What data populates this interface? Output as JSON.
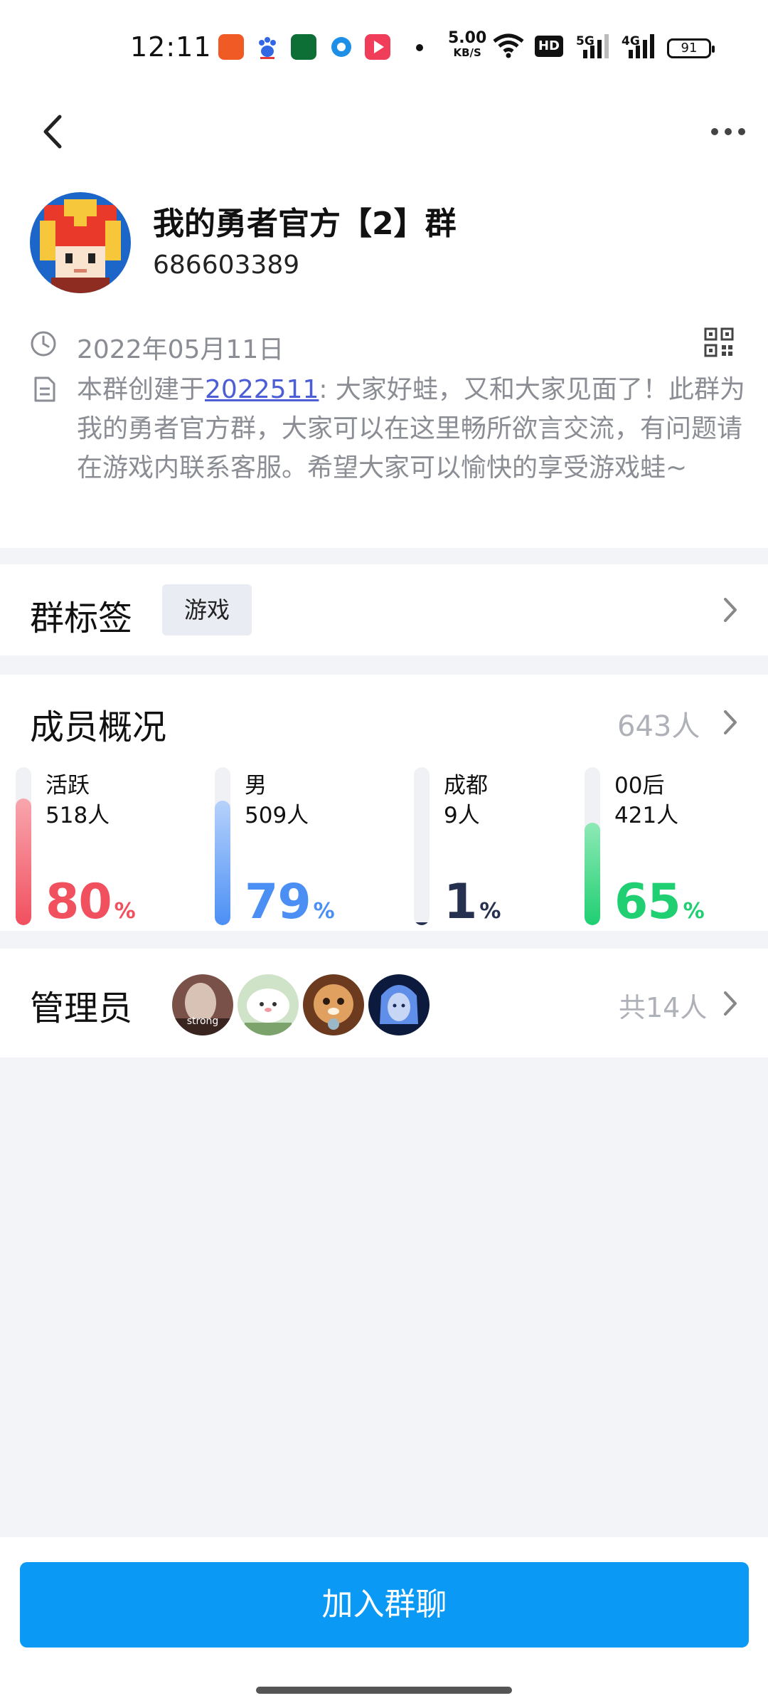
{
  "status_bar": {
    "time": "12:11",
    "net_speed_value": "5.00",
    "net_speed_unit": "KB/S",
    "battery": "91",
    "signal_labels": [
      "HD",
      "5G",
      "4G"
    ]
  },
  "header": {
    "back_icon": "chevron-left-icon",
    "more_icon": "more-dots-icon"
  },
  "group": {
    "name": "我的勇者官方【2】群",
    "id": "686603389",
    "created_date": "2022年05月11日",
    "description_prefix": "本群创建于",
    "description_link": "2022511",
    "description_suffix": ": 大家好蛙，又和大家见面了！此群为我的勇者官方群，大家可以在这里畅所欲言交流，有问题请在游戏内联系客服。希望大家可以愉快的享受游戏蛙~"
  },
  "tags": {
    "title": "群标签",
    "chip": "游戏"
  },
  "members": {
    "title": "成员概况",
    "count": "643人",
    "stats": [
      {
        "label": "活跃",
        "count": "518人",
        "percent": "80",
        "fraction": 0.8,
        "color": "#f1505f",
        "color_light": "#f8a6ae"
      },
      {
        "label": "男",
        "count": "509人",
        "percent": "79",
        "fraction": 0.79,
        "color": "#4b8ff5",
        "color_light": "#b7d2fb"
      },
      {
        "label": "成都",
        "count": "9人",
        "percent": "1",
        "fraction": 0.01,
        "color": "#263150",
        "color_light": "#263150"
      },
      {
        "label": "00后",
        "count": "421人",
        "percent": "65",
        "fraction": 0.65,
        "color": "#1fcf72",
        "color_light": "#8fe9b6"
      }
    ],
    "percent_symbol": "%"
  },
  "admins": {
    "title": "管理员",
    "avatar_caption": "strong",
    "count": "共14人"
  },
  "join_button": "加入群聊"
}
